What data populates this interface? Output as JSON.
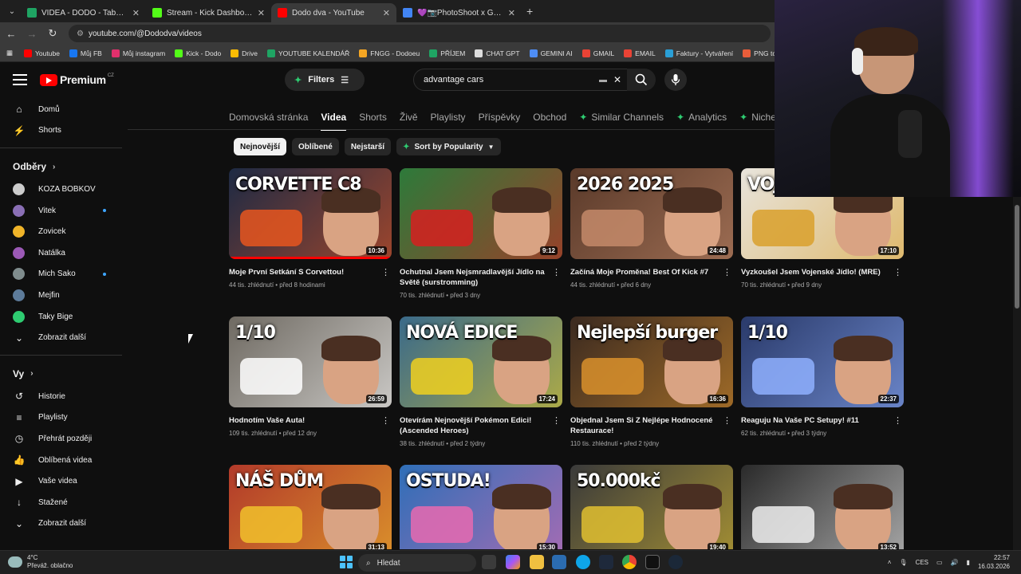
{
  "browser": {
    "tabs": [
      {
        "title": "VIDEA - DODO - Tabulky Googl",
        "color": "#1fa463",
        "active": false
      },
      {
        "title": "Stream - Kick Dashboard",
        "color": "#53fc18",
        "active": false
      },
      {
        "title": "Dodo dva - YouTube",
        "color": "#ff0000",
        "active": true
      },
      {
        "title": "💜📷PhotoShoot x Green Scr",
        "color": "#4285f4",
        "active": false
      }
    ],
    "url": "youtube.com/@Dododva/videos",
    "bookmarks": [
      {
        "label": "Youtube",
        "color": "#ff0000"
      },
      {
        "label": "Můj FB",
        "color": "#1877f2"
      },
      {
        "label": "Můj instagram",
        "color": "#e1306c"
      },
      {
        "label": "Kick - Dodo",
        "color": "#53fc18"
      },
      {
        "label": "Drive",
        "color": "#fbbc04"
      },
      {
        "label": "YOUTUBE KALENDÁŘ",
        "color": "#1fa463"
      },
      {
        "label": "FNGG - Dodoeu",
        "color": "#f5a623"
      },
      {
        "label": "PŘÍJEM",
        "color": "#1fa463"
      },
      {
        "label": "CHAT GPT",
        "color": "#dddddd"
      },
      {
        "label": "GEMINI AI",
        "color": "#4e8df5"
      },
      {
        "label": "GMAIL",
        "color": "#ea4335"
      },
      {
        "label": "EMAIL",
        "color": "#ea4335"
      },
      {
        "label": "Faktury - Vytváření",
        "color": "#2a9fd6"
      },
      {
        "label": "PNG to PDF",
        "color": "#e85d3a"
      }
    ]
  },
  "yt": {
    "logo_text": "Premium",
    "logo_region": "CZ",
    "filters_label": "Filters",
    "search_value": "advantage cars",
    "sidebar": {
      "main": [
        {
          "label": "Domů",
          "icon": "home-icon",
          "glyph": "⌂"
        },
        {
          "label": "Shorts",
          "icon": "shorts-icon",
          "glyph": "⚡"
        }
      ],
      "subs_header": "Odběry",
      "subs": [
        {
          "label": "KOZA BOBKOV",
          "color": "#cccccc",
          "dot": false
        },
        {
          "label": "Vitek",
          "color": "#8a6fb5",
          "dot": true
        },
        {
          "label": "Zovicek",
          "color": "#f0b429",
          "dot": false
        },
        {
          "label": "Natálka",
          "color": "#9b59b6",
          "dot": false
        },
        {
          "label": "Mich Sako",
          "color": "#7f8c8d",
          "dot": true
        },
        {
          "label": "Mejfin",
          "color": "#5d7b9a",
          "dot": false
        },
        {
          "label": "Taky Bige",
          "color": "#2ecc71",
          "dot": false
        }
      ],
      "subs_more": "Zobrazit další",
      "you_header": "Vy",
      "you": [
        {
          "label": "Historie",
          "icon": "history-icon",
          "glyph": "↺"
        },
        {
          "label": "Playlisty",
          "icon": "playlists-icon",
          "glyph": "≡"
        },
        {
          "label": "Přehrát později",
          "icon": "watch-later-icon",
          "glyph": "◷"
        },
        {
          "label": "Oblíbená videa",
          "icon": "liked-icon",
          "glyph": "👍"
        },
        {
          "label": "Vaše videa",
          "icon": "your-videos-icon",
          "glyph": "▶"
        },
        {
          "label": "Stažené",
          "icon": "downloads-icon",
          "glyph": "↓"
        }
      ],
      "you_more": "Zobrazit další"
    },
    "channel_tabs": [
      "Domovská stránka",
      "Videa",
      "Shorts",
      "Živě",
      "Playlisty",
      "Příspěvky",
      "Obchod"
    ],
    "channel_tabs_ext": [
      "Similar Channels",
      "Analytics",
      "Niche Ove"
    ],
    "chips": [
      "Nejnovější",
      "Oblíbené",
      "Nejstarší"
    ],
    "sort_label": "Sort by Popularity",
    "videos": [
      {
        "title": "Moje První Setkání S Corvettou!",
        "meta": "44 tis. zhlédnutí • před 8 hodinami",
        "duration": "10:36",
        "caption": "CORVETTE C8",
        "bg": "#1d2a44",
        "accent": "#e8561f",
        "watched": 1.0
      },
      {
        "title": "Ochutnal Jsem Nejsmradlavější Jídlo na Světě (surstromming)",
        "meta": "70 tis. zhlédnutí • před 3 dny",
        "duration": "9:12",
        "caption": "",
        "bg": "#2d7a3a",
        "accent": "#d62020",
        "watched": 0
      },
      {
        "title": "Začíná Moje Proměna! Best Of Kick #7",
        "meta": "44 tis. zhlédnutí • před 6 dny",
        "duration": "24:48",
        "caption": "2026 2025",
        "bg": "#5a3a2a",
        "accent": "#c48a6a",
        "watched": 0
      },
      {
        "title": "Vyzkoušel Jsem Vojenské Jídlo! (MRE)",
        "meta": "70 tis. zhlédnutí • před 9 dny",
        "duration": "17:10",
        "caption": "VOJ",
        "bg": "#e8e4dc",
        "accent": "#d9a02c",
        "watched": 0
      },
      {
        "title": "Hodnotím Vaše Auta!",
        "meta": "109 tis. zhlédnutí • před 12 dny",
        "duration": "26:59",
        "caption": "1/10",
        "bg": "#6f6a62",
        "accent": "#ffffff",
        "watched": 0
      },
      {
        "title": "Otevírám Nejnovější Pokémon Edici! (Ascended Heroes)",
        "meta": "38 tis. zhlédnutí • před 2 týdny",
        "duration": "17:24",
        "caption": "NOVÁ EDICE",
        "bg": "#3a6a8a",
        "accent": "#f0d020",
        "watched": 0
      },
      {
        "title": "Objednal Jsem Si Z Nejlépe Hodnocené Restaurace!",
        "meta": "110 tis. zhlédnutí • před 2 týdny",
        "duration": "16:36",
        "caption": "Nejlepší burger",
        "bg": "#3b2a20",
        "accent": "#d9902c",
        "watched": 0
      },
      {
        "title": "Reaguju Na Vaše PC Setupy! #11",
        "meta": "62 tis. zhlédnutí • před 3 týdny",
        "duration": "22:37",
        "caption": "1/10",
        "bg": "#2a3a6a",
        "accent": "#8fb0ff",
        "watched": 0
      },
      {
        "title": "",
        "meta": "",
        "duration": "31:13",
        "caption": "NÁŠ DŮM",
        "bg": "#b23a2a",
        "accent": "#f1c12c",
        "watched": 0
      },
      {
        "title": "",
        "meta": "",
        "duration": "15:30",
        "caption": "OSTUDA!",
        "bg": "#2f6fb8",
        "accent": "#e86ab0",
        "watched": 0
      },
      {
        "title": "",
        "meta": "",
        "duration": "19:40",
        "caption": "50.000kč",
        "bg": "#3a3a3a",
        "accent": "#e0c030",
        "watched": 0
      },
      {
        "title": "",
        "meta": "",
        "duration": "13:52",
        "caption": "",
        "bg": "#2a2a2a",
        "accent": "#eeeeee",
        "watched": 0
      }
    ]
  },
  "taskbar": {
    "temp": "4°C",
    "weather": "Převáž. oblačno",
    "search": "Hledat",
    "lang": "CES",
    "time": "22:57",
    "date": "16.03.2026"
  }
}
